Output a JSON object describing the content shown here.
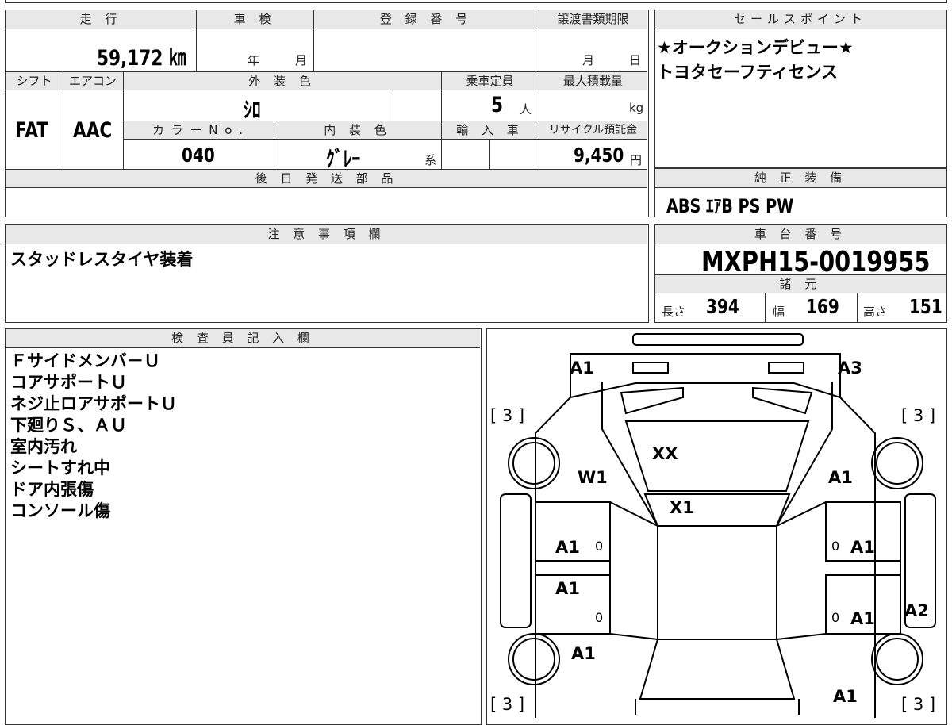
{
  "main": {
    "headers": {
      "mileage": "走 行",
      "shaken": "車 検",
      "reg_no": "登 録 番 号",
      "doc_deadline": "譲渡書類期限",
      "shift": "シフト",
      "aircon": "エアコン",
      "exterior": "外 装 色",
      "capacity": "乗車定員",
      "max_load": "最大積載量",
      "color_no": "カ ラ ー N o .",
      "interior": "内 装 色",
      "import": "輸 入 車",
      "recycle": "リサイクル預託金",
      "later_parts": "後 日 発 送 部 品"
    },
    "mileage_value": "59,172 ㎞",
    "shaken_year_unit": "年",
    "shaken_month_unit": "月",
    "doc_month_unit": "月",
    "doc_day_unit": "日",
    "shift_value": "FAT",
    "aircon_value": "AAC",
    "exterior_value": "ｼﾛ",
    "capacity_value": "5",
    "capacity_unit": "人",
    "max_load_unit": "kg",
    "color_no_value": "040",
    "interior_value": "ｸﾞﾚｰ",
    "interior_suffix": "系",
    "recycle_value": "9,450",
    "recycle_unit": "円"
  },
  "sales": {
    "header": "セールスポイント",
    "lines": [
      "★オークションデビュー★",
      "トヨタセーフティセンス"
    ]
  },
  "equipment": {
    "header": "純 正 装 備",
    "value": "ABS ｴｱB PS PW"
  },
  "notes": {
    "header": "注 意 事 項 欄",
    "value": "スタッドレスタイヤ装着"
  },
  "chassis": {
    "header": "車 台 番 号",
    "value": "MXPH15-0019955",
    "spec_header": "諸 元",
    "length_label": "長さ",
    "length_value": "394",
    "width_label": "幅",
    "width_value": "169",
    "height_label": "高さ",
    "height_value": "151"
  },
  "inspector": {
    "header": "検 査 員 記 入 欄",
    "lines": [
      "Ｆサイドメンバ－Ｕ",
      "コアサポートＵ",
      "ネジ止ロアサポートＵ",
      "下廻りＳ、ＡＵ",
      "室内汚れ",
      "シートすれ中",
      "ドア内張傷",
      "コンソール傷"
    ]
  },
  "diagram": {
    "marks": {
      "front_left": "A1",
      "front_right": "A3",
      "tire_fl": "[ 3 ]",
      "tire_fr": "[ 3 ]",
      "tire_rl": "[ 3 ]",
      "tire_rr": "[ 3 ]",
      "windshield": "XX",
      "roof_front": "X1",
      "fender_left": "W1",
      "fender_right": "A1",
      "door_fl": "A1",
      "door_fr": "A1",
      "door_rl": "A1",
      "door_rr": "A1",
      "quarter_left": "A1",
      "quarter_right": "A2",
      "rear_right": "A1",
      "zero_fl": "0",
      "zero_fr": "0",
      "zero_rl": "0",
      "zero_rr": "0"
    }
  }
}
